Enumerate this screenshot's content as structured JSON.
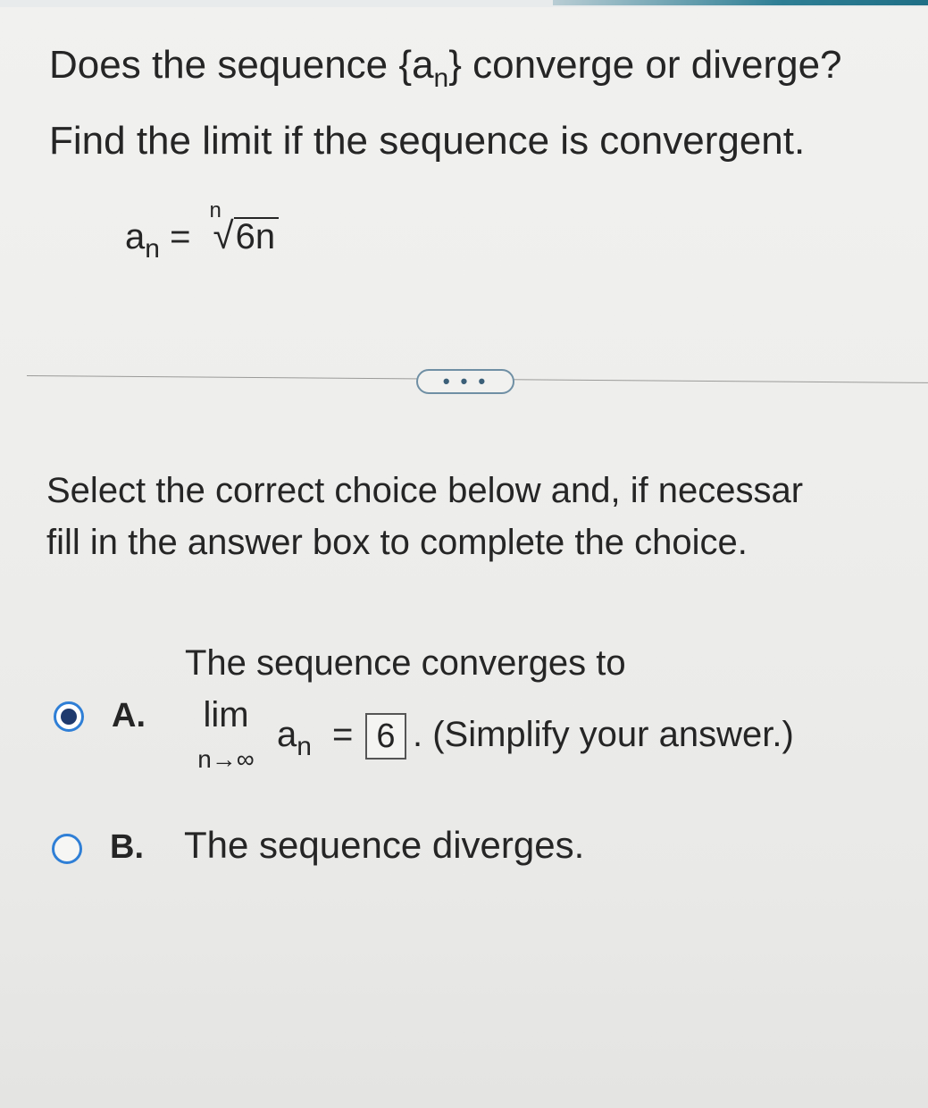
{
  "question": {
    "line1_prefix": "Does the sequence {a",
    "line1_sub": "n",
    "line1_suffix": "} converge or diverge?",
    "line2": "Find the limit if the sequence is convergent."
  },
  "formula": {
    "var": "a",
    "var_sub": "n",
    "equals": "=",
    "root_index": "n",
    "root_sign": "√",
    "radicand": "6n"
  },
  "more_button": {
    "label": "• • •"
  },
  "instructions": {
    "line1": "Select the correct choice below and, if necessar",
    "line2": "fill in the answer box to complete the choice."
  },
  "choices": {
    "a": {
      "letter": "A.",
      "selected": true,
      "intro": "The sequence converges to",
      "lim_word": "lim",
      "lim_sub": "n→∞",
      "term": "a",
      "term_sub": "n",
      "equals": "=",
      "answer_value": "6",
      "suffix": ". (Simplify your answer.)"
    },
    "b": {
      "letter": "B.",
      "selected": false,
      "text": "The sequence diverges."
    }
  },
  "colors": {
    "radio_ring": "#2f7fd6",
    "radio_dot": "#1f3a6e",
    "button_border": "#6f8fa4",
    "top_accent": "#1f6f86"
  }
}
